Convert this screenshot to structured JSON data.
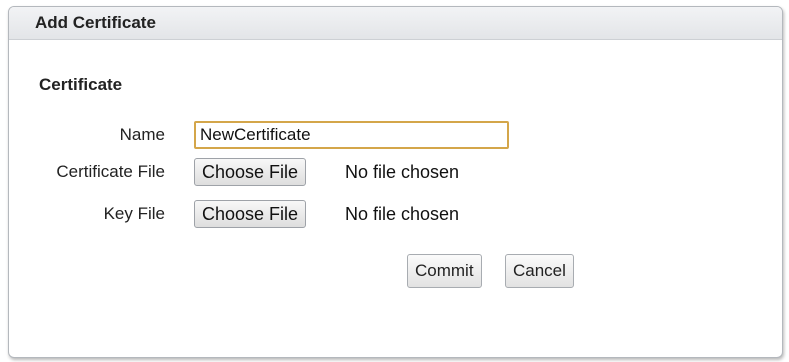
{
  "dialog": {
    "title": "Add Certificate",
    "section_title": "Certificate"
  },
  "form": {
    "name": {
      "label": "Name",
      "value": "NewCertificate"
    },
    "certificate_file": {
      "label": "Certificate File",
      "button_label": "Choose File",
      "status": "No file chosen"
    },
    "key_file": {
      "label": "Key File",
      "button_label": "Choose File",
      "status": "No file chosen"
    }
  },
  "actions": {
    "commit_label": "Commit",
    "cancel_label": "Cancel"
  },
  "colors": {
    "focused_input_border": "#d4a64a",
    "titlebar": "#e3e5e8"
  }
}
